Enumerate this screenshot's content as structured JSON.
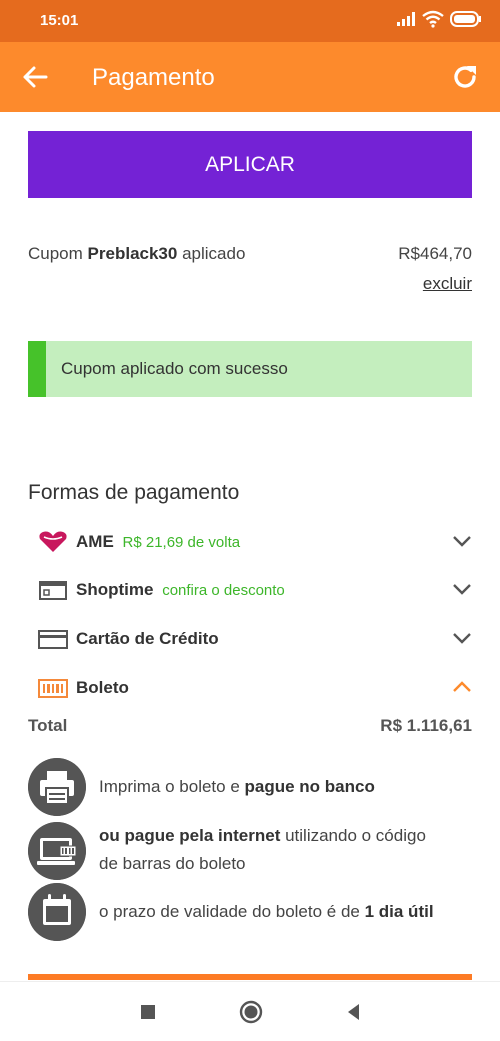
{
  "status_bar": {
    "time": "15:01"
  },
  "app_bar": {
    "title": "Pagamento"
  },
  "apply_button": {
    "label": "APLICAR"
  },
  "coupon": {
    "prefix": "Cupom",
    "code": "Preblack30",
    "suffix": "aplicado",
    "value": "R$464,70",
    "remove_label": "excluir"
  },
  "success_message": "Cupom aplicado com sucesso",
  "payment_section": {
    "title": "Formas de pagamento",
    "methods": [
      {
        "label": "AME",
        "sub": "R$ 21,69 de volta",
        "icon": "ame-heart-icon",
        "expanded": false
      },
      {
        "label": "Shoptime",
        "sub": "confira o desconto",
        "icon": "shoptime-card-icon",
        "expanded": false
      },
      {
        "label": "Cartão de Crédito",
        "sub": "",
        "icon": "credit-card-icon",
        "expanded": false
      },
      {
        "label": "Boleto",
        "sub": "",
        "icon": "barcode-icon",
        "expanded": true
      }
    ]
  },
  "total": {
    "label": "Total",
    "value": "R$ 1.116,61"
  },
  "boleto_info": [
    {
      "icon": "printer-icon",
      "text_a": "Imprima o boleto e ",
      "bold_b": "pague no banco",
      "text_c": ""
    },
    {
      "icon": "computer-barcode-icon",
      "bold_a": "ou pague pela internet",
      "text_b": " utilizando o código",
      "text_c": "de barras do boleto"
    },
    {
      "icon": "calendar-icon",
      "text_a": "o prazo de validade do boleto é de ",
      "bold_b": "1 dia útil"
    }
  ],
  "colors": {
    "status_bar": "#e56b1e",
    "app_bar": "#fd8a2c",
    "apply_button": "#7422d5",
    "success_bg": "#c4eebe",
    "success_accent": "#46c22a",
    "green_text": "#3db62a",
    "ame_pink": "#c8175d"
  }
}
